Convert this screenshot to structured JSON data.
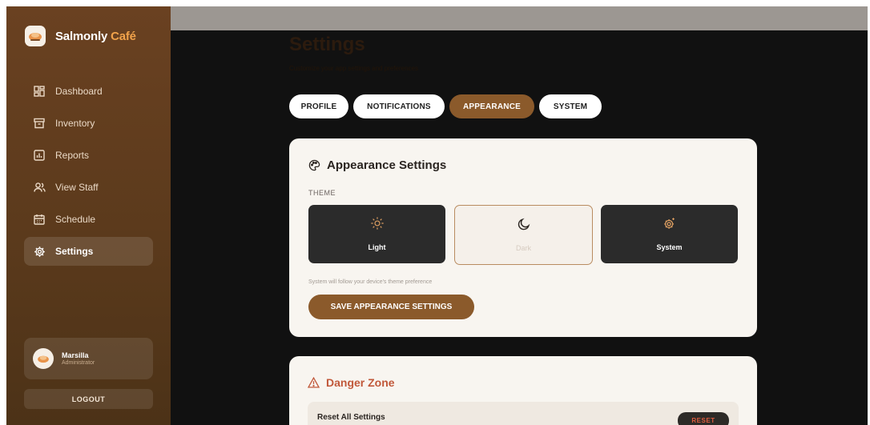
{
  "brand": {
    "name_main": "Salmonly",
    "name_accent": "Café",
    "logo_icon": "cafe-logo-icon"
  },
  "sidebar": {
    "items": [
      {
        "label": "Dashboard",
        "icon": "dashboard-grid-icon",
        "active": false
      },
      {
        "label": "Inventory",
        "icon": "archive-box-icon",
        "active": false
      },
      {
        "label": "Reports",
        "icon": "bar-chart-icon",
        "active": false
      },
      {
        "label": "View Staff",
        "icon": "users-icon",
        "active": false
      },
      {
        "label": "Schedule",
        "icon": "calendar-icon",
        "active": false
      },
      {
        "label": "Settings",
        "icon": "gear-icon",
        "active": true
      }
    ],
    "user": {
      "name": "Marsilla",
      "role": "Administrator",
      "avatar_icon": "avatar"
    },
    "logout_label": "LOGOUT"
  },
  "page": {
    "title": "Settings",
    "subtitle": "Customize your app settings and preferences"
  },
  "tabs": [
    {
      "label": "PROFILE",
      "active": false
    },
    {
      "label": "NOTIFICATIONS",
      "active": false
    },
    {
      "label": "APPEARANCE",
      "active": true
    },
    {
      "label": "SYSTEM",
      "active": false
    }
  ],
  "appearance": {
    "title": "Appearance Settings",
    "title_icon": "palette-icon",
    "theme_label": "THEME",
    "options": [
      {
        "label": "Light",
        "icon": "sun-icon",
        "selected": false
      },
      {
        "label": "Dark",
        "icon": "moon-icon",
        "selected": true
      },
      {
        "label": "System",
        "icon": "system-gear-icon",
        "selected": false
      }
    ],
    "hint": "System will follow your device's theme preference",
    "save_label": "SAVE APPEARANCE SETTINGS"
  },
  "danger": {
    "title": "Danger Zone",
    "title_icon": "warning-triangle-icon",
    "reset_row_label": "Reset All Settings",
    "reset_label": "RESET"
  },
  "colors": {
    "accent": "#8b5a2b",
    "sidebar": "#5e3c1e",
    "danger": "#c1583a",
    "brand_accent": "#f1a24a"
  }
}
